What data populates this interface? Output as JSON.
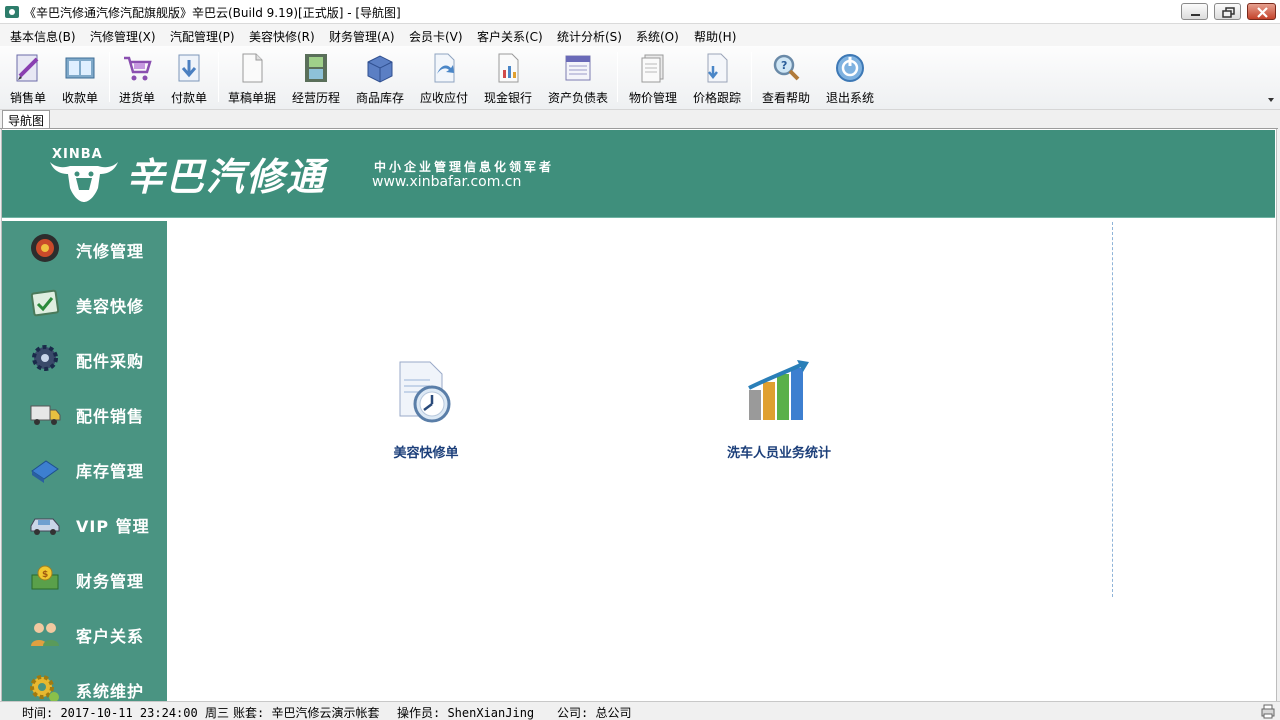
{
  "window": {
    "title": "《辛巴汽修通汽修汽配旗舰版》辛巴云(Build 9.19)[正式版] - [导航图]"
  },
  "menu": [
    {
      "label": "基本信息(B)"
    },
    {
      "label": "汽修管理(X)"
    },
    {
      "label": "汽配管理(P)"
    },
    {
      "label": "美容快修(R)"
    },
    {
      "label": "财务管理(A)"
    },
    {
      "label": "会员卡(V)"
    },
    {
      "label": "客户关系(C)"
    },
    {
      "label": "统计分析(S)"
    },
    {
      "label": "系统(O)"
    },
    {
      "label": "帮助(H)"
    }
  ],
  "toolbar": [
    {
      "label": "销售单",
      "icon": "sales-order-icon"
    },
    {
      "label": "收款单",
      "icon": "receipt-icon"
    },
    {
      "label": "进货单",
      "icon": "purchase-cart-icon"
    },
    {
      "label": "付款单",
      "icon": "payment-icon"
    },
    {
      "label": "草稿单据",
      "icon": "draft-icon"
    },
    {
      "label": "经营历程",
      "icon": "film-history-icon"
    },
    {
      "label": "商品库存",
      "icon": "inventory-box-icon"
    },
    {
      "label": "应收应付",
      "icon": "receivable-icon"
    },
    {
      "label": "现金银行",
      "icon": "cash-bank-icon"
    },
    {
      "label": "资产负债表",
      "icon": "balance-sheet-icon"
    },
    {
      "label": "物价管理",
      "icon": "price-manage-icon"
    },
    {
      "label": "价格跟踪",
      "icon": "price-track-icon"
    },
    {
      "label": "查看帮助",
      "icon": "help-magnifier-icon"
    },
    {
      "label": "退出系统",
      "icon": "exit-icon"
    }
  ],
  "tab": {
    "label": "导航图"
  },
  "banner": {
    "brand_en": "XINBA",
    "brand_name": "辛巴汽修通",
    "slogan": "中小企业管理信息化领军者",
    "url": "www.xinbafar.com.cn",
    "color": "#3f8f7c"
  },
  "sidebar": [
    {
      "label": "汽修管理",
      "icon": "car-repair-icon"
    },
    {
      "label": "美容快修",
      "icon": "beauty-repair-icon"
    },
    {
      "label": "配件采购",
      "icon": "parts-purchase-icon"
    },
    {
      "label": "配件销售",
      "icon": "parts-sales-truck-icon"
    },
    {
      "label": "库存管理",
      "icon": "inventory-book-icon"
    },
    {
      "label": "VIP 管理",
      "icon": "vip-car-icon"
    },
    {
      "label": "财务管理",
      "icon": "finance-money-icon"
    },
    {
      "label": "客户关系",
      "icon": "customers-icon"
    },
    {
      "label": "系统维护",
      "icon": "system-gear-icon"
    }
  ],
  "shortcuts": [
    {
      "label": "美容快修单",
      "icon": "document-clock-icon"
    },
    {
      "label": "洗车人员业务统计",
      "icon": "bar-chart-growth-icon"
    }
  ],
  "status": {
    "time": "时间: 2017-10-11 23:24:00 周三",
    "account": "账套: 辛巴汽修云演示帐套",
    "operator": "操作员: ShenXianJing",
    "company": "公司: 总公司"
  }
}
